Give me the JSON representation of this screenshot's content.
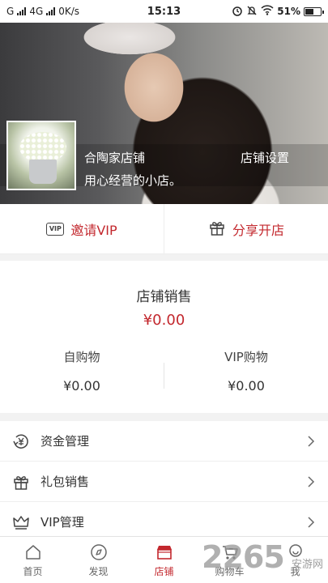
{
  "status_bar": {
    "carrier1": "G",
    "carrier2": "4G",
    "speed": "0K/s",
    "time": "15:13",
    "battery": "51%",
    "icons": [
      "signal-icon",
      "signal-icon",
      "alarm-icon",
      "silent-icon",
      "wifi-icon",
      "battery-icon"
    ]
  },
  "shop": {
    "name": "合陶家店铺",
    "description": "用心经营的小店。",
    "settings_label": "店铺设置"
  },
  "actions": [
    {
      "label": "邀请VIP",
      "icon": "vip-icon",
      "vip_badge": "VIP"
    },
    {
      "label": "分享开店",
      "icon": "gift-icon"
    }
  ],
  "sales": {
    "title": "店铺销售",
    "total": "¥0.00",
    "self_purchase_label": "自购物",
    "self_purchase_value": "¥0.00",
    "vip_purchase_label": "VIP购物",
    "vip_purchase_value": "¥0.00"
  },
  "menu": [
    {
      "label": "资金管理",
      "icon": "fund-icon"
    },
    {
      "label": "礼包销售",
      "icon": "gift-icon"
    },
    {
      "label": "VIP管理",
      "icon": "crown-icon"
    }
  ],
  "tabs": [
    {
      "label": "首页",
      "icon": "home-icon"
    },
    {
      "label": "发现",
      "icon": "compass-icon"
    },
    {
      "label": "店铺",
      "icon": "store-icon",
      "active": true
    },
    {
      "label": "购物车",
      "icon": "cart-icon"
    },
    {
      "label": "我",
      "icon": "user-icon"
    }
  ],
  "watermark": {
    "number": "2265",
    "suffix": "安游网"
  },
  "colors": {
    "accent": "#c3282e",
    "background": "#f2f2f2"
  }
}
